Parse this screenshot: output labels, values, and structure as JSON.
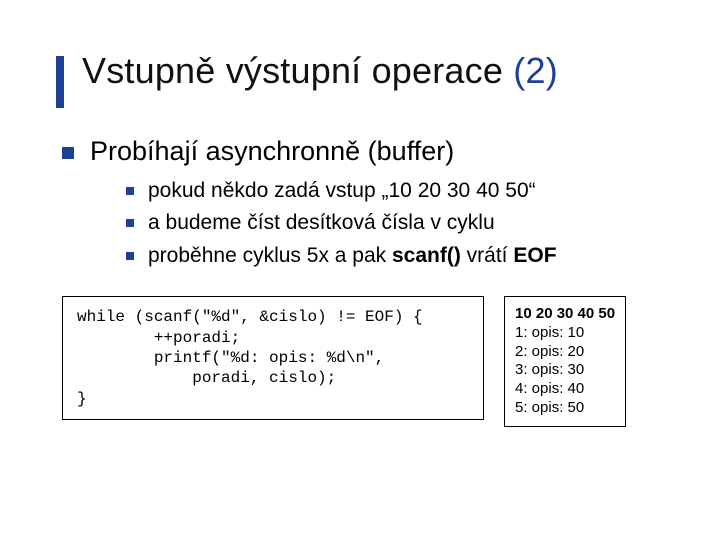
{
  "title_plain": "Vstupně výstupní operace ",
  "title_blue": "(2)",
  "main": "Probíhají asynchronně (buffer)",
  "subs": {
    "a": "pokud někdo zadá vstup „10 20 30 40 50“",
    "b": "a budeme číst desítková čísla v cyklu",
    "c_pre": "proběhne cyklus 5x a pak ",
    "c_b1": "scanf()",
    "c_mid": " vrátí ",
    "c_b2": "EOF"
  },
  "code": "while (scanf(\"%d\", &cislo) != EOF) {\n        ++poradi;\n        printf(\"%d: opis: %d\\n\",\n            poradi, cislo);\n}",
  "out_head": "10 20 30 40 50",
  "out_body": "1: opis: 10\n2: opis: 20\n3: opis: 30\n4: opis: 40\n5: opis: 50"
}
